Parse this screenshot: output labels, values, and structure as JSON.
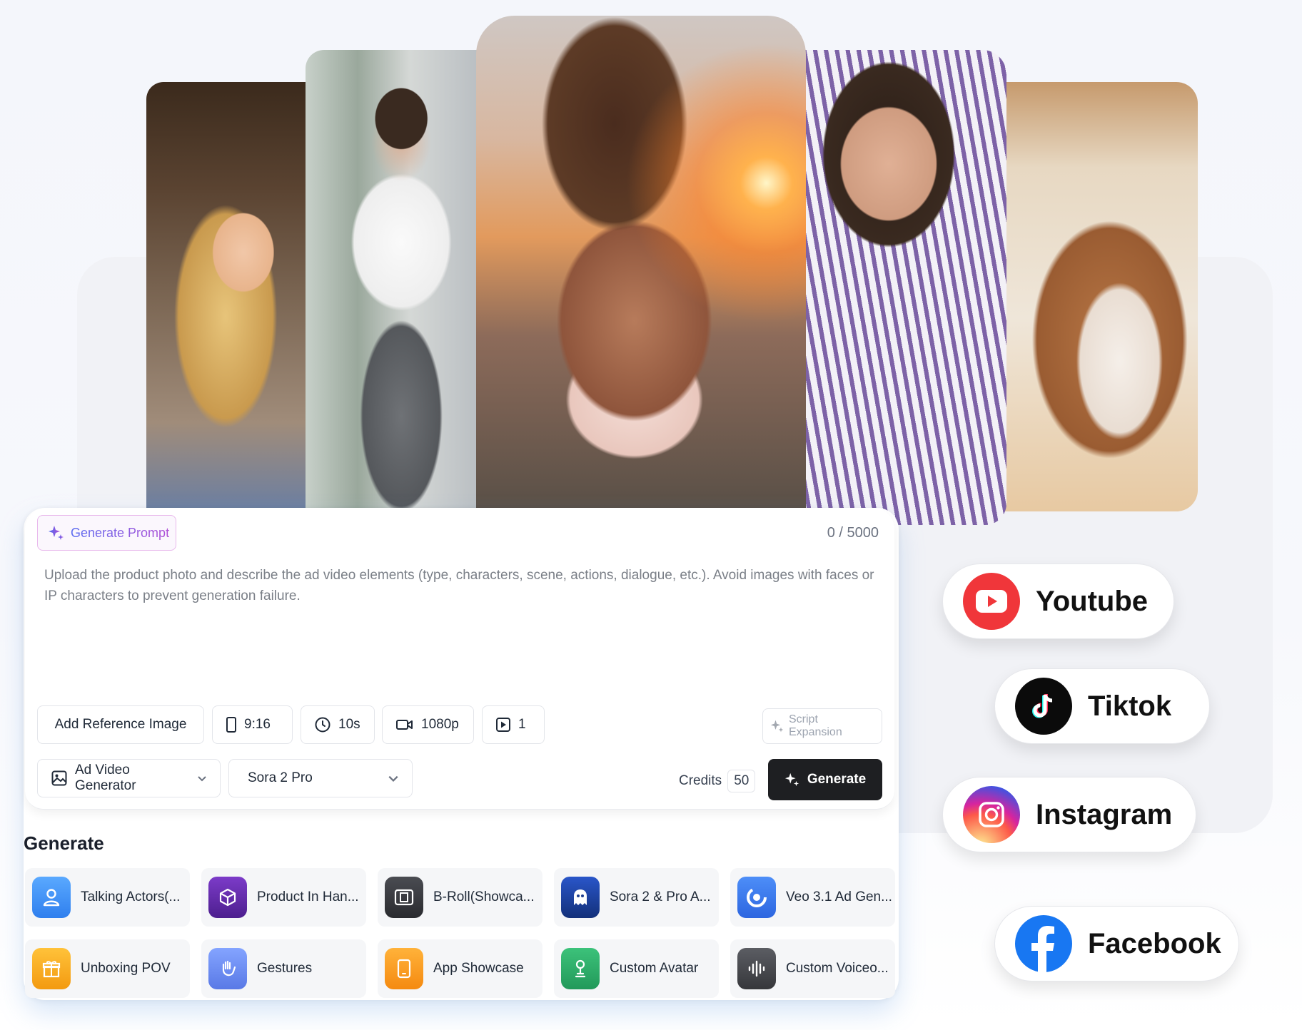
{
  "composer": {
    "generate_prompt_label": "Generate Prompt",
    "char_counter": "0 / 5000",
    "placeholder": "Upload the product photo and describe the ad video elements (type, characters, scene, actions, dialogue, etc.). Avoid images with faces or IP characters to prevent generation failure.",
    "add_reference_label": "Add Reference Image",
    "aspect_ratio": "9:16",
    "duration": "10s",
    "resolution": "1080p",
    "count": "1",
    "script_expansion_label": "Script Expansion",
    "mode_select": "Ad Video Generator",
    "model_select": "Sora 2 Pro",
    "credits_label": "Credits",
    "credits_value": "50",
    "generate_label": "Generate"
  },
  "generate_section": {
    "title": "Generate",
    "tiles": [
      {
        "label": "Talking Actors(...",
        "icon": "person-icon",
        "color": "#3f8ff5"
      },
      {
        "label": "Product In Han...",
        "icon": "cube-icon",
        "color": "#6a2fb6"
      },
      {
        "label": "B-Roll(Showca...",
        "icon": "film-icon",
        "color": "#3b3d42"
      },
      {
        "label": "Sora 2 & Pro A...",
        "icon": "ghost-icon",
        "color": "#1c3d8f"
      },
      {
        "label": "Veo 3.1 Ad Gen...",
        "icon": "swirl-icon",
        "color": "#3a7cf5"
      },
      {
        "label": "Unboxing POV",
        "icon": "gift-icon",
        "color": "#f5a31b"
      },
      {
        "label": "Gestures",
        "icon": "hand-icon",
        "color": "#6c8ef0"
      },
      {
        "label": "App Showcase",
        "icon": "phone-icon",
        "color": "#f59b1d"
      },
      {
        "label": "Custom Avatar",
        "icon": "avatar-pin-icon",
        "color": "#2fb06b"
      },
      {
        "label": "Custom Voiceo...",
        "icon": "waveform-icon",
        "color": "#4a4c52"
      }
    ]
  },
  "social": [
    {
      "label": "Youtube",
      "icon": "youtube-icon",
      "color": "#f0363a"
    },
    {
      "label": "Tiktok",
      "icon": "tiktok-icon",
      "color": "#0b0b0b"
    },
    {
      "label": "Instagram",
      "icon": "instagram-icon",
      "color": "#e1306c"
    },
    {
      "label": "Facebook",
      "icon": "facebook-icon",
      "color": "#1877f2"
    }
  ],
  "photos": [
    "blonde-woman-photo",
    "teen-boy-photo",
    "sunset-woman-photo",
    "striped-shirt-woman-photo",
    "dog-photo"
  ]
}
